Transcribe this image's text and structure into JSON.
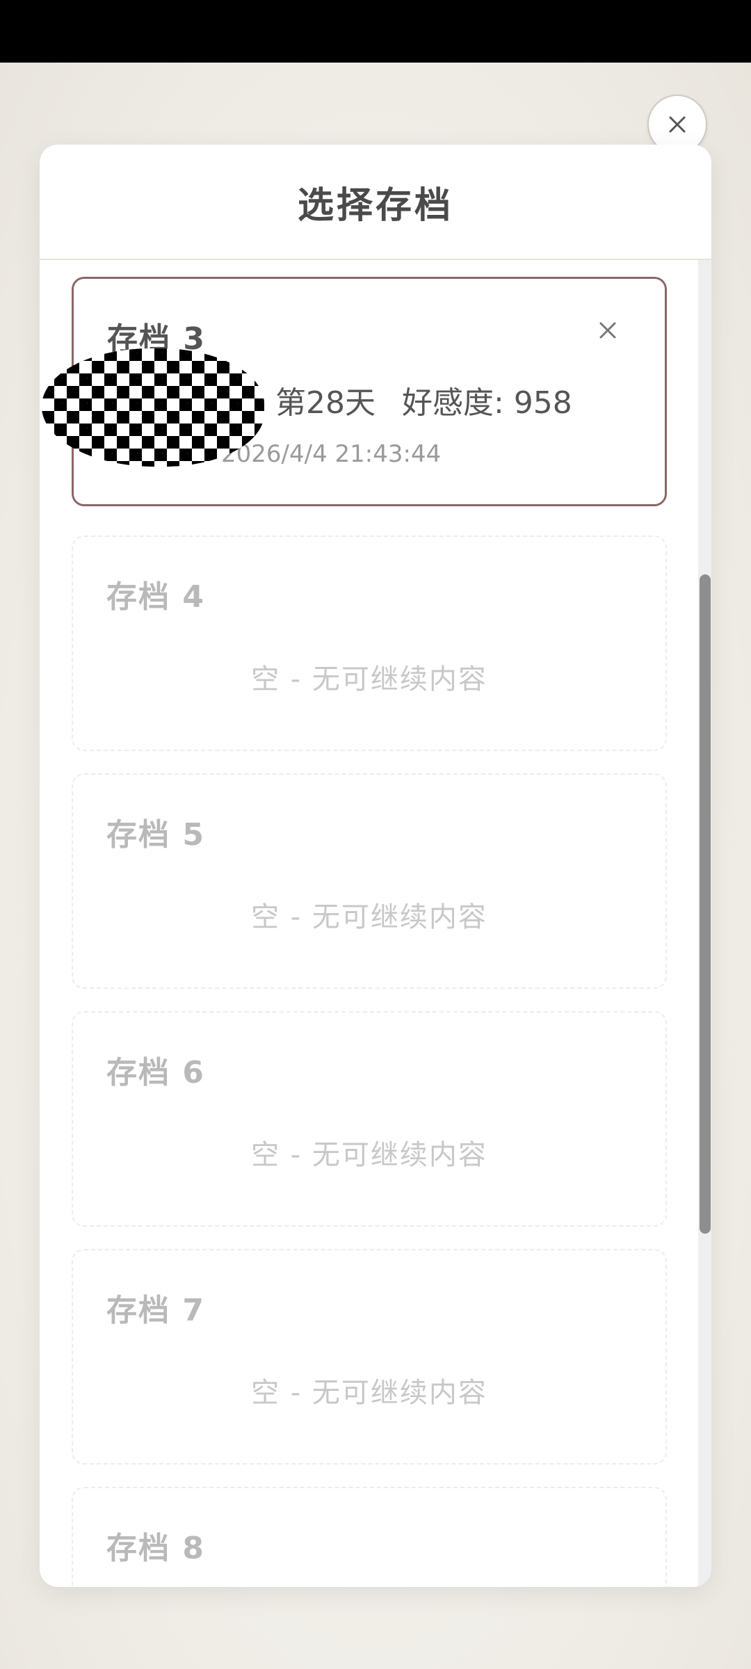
{
  "modal": {
    "title": "选择存档",
    "close_icon": "close-icon"
  },
  "slots": [
    {
      "title": "存档 3",
      "status": "filled",
      "day": "第28天",
      "affection": "好感度: 958",
      "time": "2026/4/4 21:43:44",
      "delete_icon": "close-icon"
    },
    {
      "title": "存档 4",
      "status": "empty",
      "empty_text": "空 - 无可继续内容"
    },
    {
      "title": "存档 5",
      "status": "empty",
      "empty_text": "空 - 无可继续内容"
    },
    {
      "title": "存档 6",
      "status": "empty",
      "empty_text": "空 - 无可继续内容"
    },
    {
      "title": "存档 7",
      "status": "empty",
      "empty_text": "空 - 无可继续内容"
    },
    {
      "title": "存档 8",
      "status": "empty"
    }
  ],
  "colors": {
    "accent_border": "#8a6767",
    "background": "#f3f1ec",
    "scrollbar": "#8e8e8e"
  }
}
